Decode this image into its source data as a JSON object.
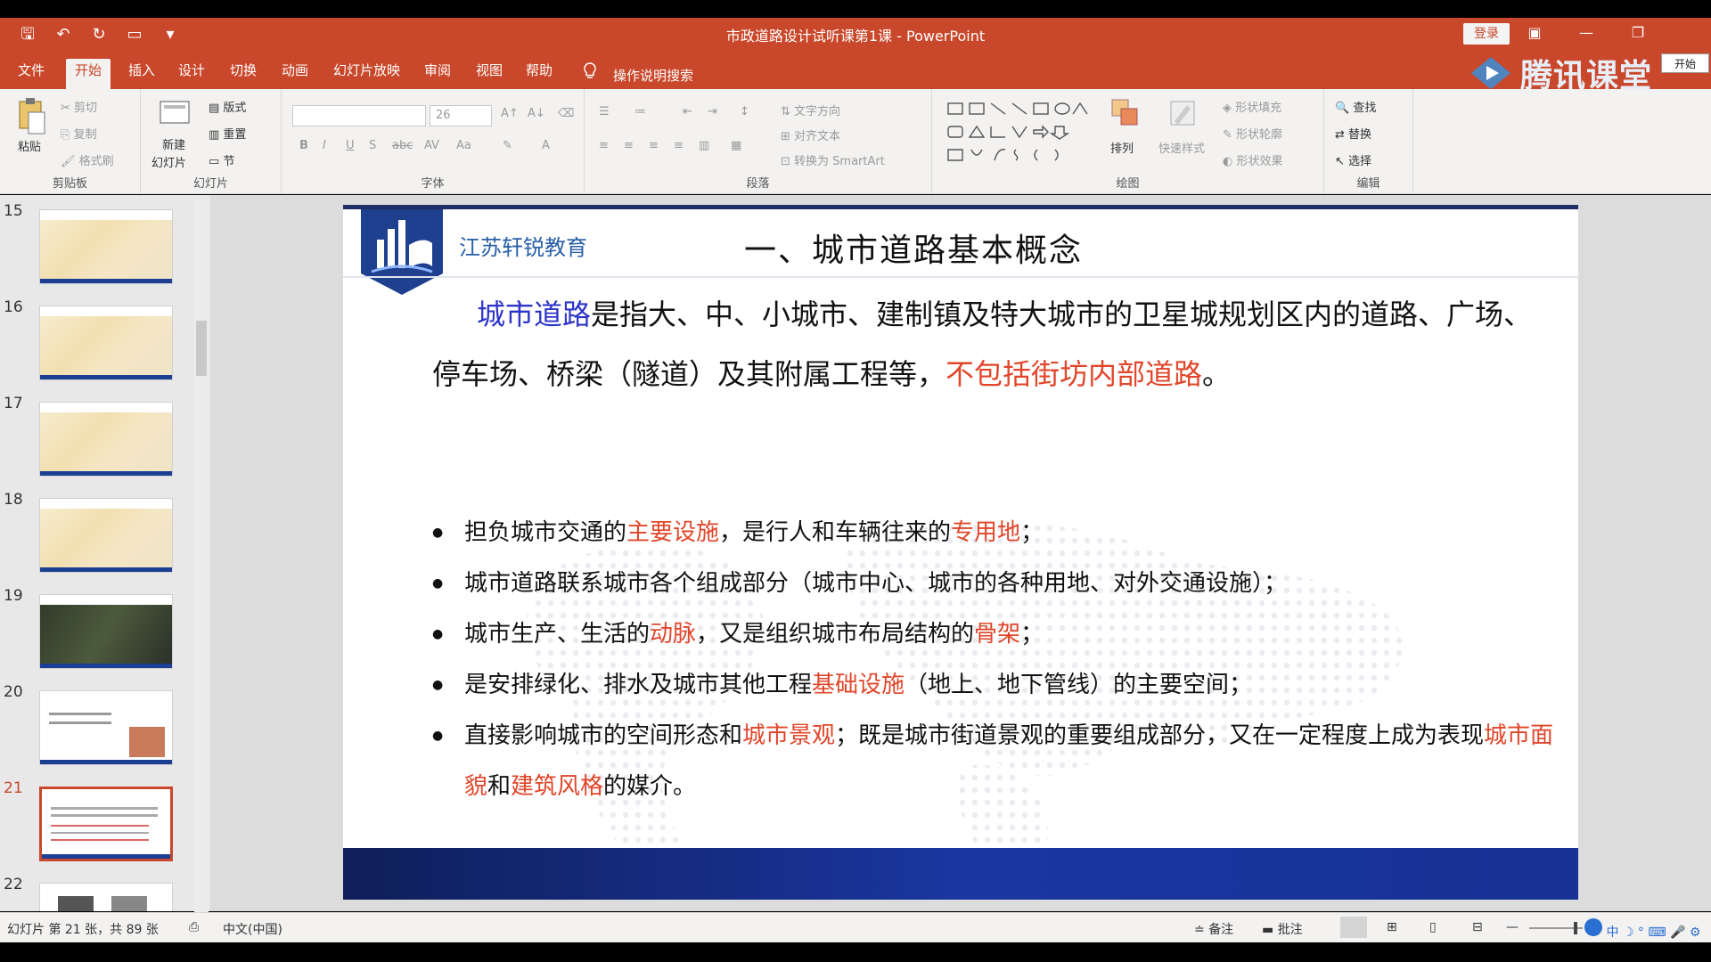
{
  "window": {
    "title": "市政道路设计试听课第1课 - PowerPoint",
    "login_label": "登录",
    "brand_name": "腾讯课堂",
    "brand_start": "开始"
  },
  "tabs": [
    {
      "label": "文件"
    },
    {
      "label": "开始",
      "active": true
    },
    {
      "label": "插入"
    },
    {
      "label": "设计"
    },
    {
      "label": "切换"
    },
    {
      "label": "动画"
    },
    {
      "label": "幻灯片放映"
    },
    {
      "label": "审阅"
    },
    {
      "label": "视图"
    },
    {
      "label": "帮助"
    }
  ],
  "tellme": "操作说明搜索",
  "ribbon": {
    "clipboard": {
      "label": "剪贴板",
      "paste": "粘贴",
      "cut": "剪切",
      "copy": "复制",
      "format_painter": "格式刷"
    },
    "slides": {
      "label": "幻灯片",
      "new_slide_1": "新建",
      "new_slide_2": "幻灯片",
      "layout": "版式",
      "reset": "重置",
      "section": "节"
    },
    "font": {
      "label": "字体",
      "size": "26"
    },
    "paragraph": {
      "label": "段落",
      "text_direction": "文字方向",
      "align_text": "对齐文本",
      "smartart": "转换为 SmartArt"
    },
    "drawing": {
      "label": "绘图",
      "arrange": "排列",
      "quick_styles": "快速样式",
      "shape_fill": "形状填充",
      "shape_outline": "形状轮廓",
      "shape_effects": "形状效果"
    },
    "editing": {
      "label": "编辑",
      "find": "查找",
      "replace": "替换",
      "select": "选择"
    }
  },
  "thumbnails": [
    {
      "number": "15",
      "kind": "map",
      "selected": false
    },
    {
      "number": "16",
      "kind": "map",
      "selected": false
    },
    {
      "number": "17",
      "kind": "map",
      "selected": false
    },
    {
      "number": "18",
      "kind": "map",
      "selected": false
    },
    {
      "number": "19",
      "kind": "dark",
      "selected": false
    },
    {
      "number": "20",
      "kind": "text",
      "selected": false
    },
    {
      "number": "21",
      "kind": "text",
      "selected": true
    },
    {
      "number": "22",
      "kind": "photo",
      "selected": false
    }
  ],
  "slide": {
    "company": "江苏轩锐教育",
    "title": "一、城市道路基本概念",
    "intro": {
      "p1": "城市道路",
      "p2": "是指大、中、小城市、建制镇及特大城市的卫星城规划区内的道路、广场、停车场、桥梁（隧道）及其附属工程等，",
      "p3": "不包括街坊内部道路",
      "p4": "。"
    },
    "bullets": [
      {
        "a": "担负城市交通的",
        "b": "主要设施",
        "c": "，是行人和车辆往来的",
        "d": "专用地",
        "e": "；"
      },
      {
        "a": "城市道路联系城市各个组成部分（城市中心、城市的各种用地、对外交通设施）；"
      },
      {
        "a": "城市生产、生活的",
        "b": "动脉",
        "c": "，又是组织城市布局结构的",
        "d": "骨架",
        "e": "；"
      },
      {
        "a": "是安排绿化、排水及城市其他工程",
        "b": "基础设施",
        "c": "（地上、地下管线）的主要空间；"
      },
      {
        "a": "直接影响城市的空间形态和",
        "b": "城市景观",
        "c": "；既是城市街道景观的重要组成部分，又在一定程度上成为表现",
        "d": "城市面貌",
        "e": "和",
        "f": "建筑风格",
        "g": "的媒介。"
      }
    ]
  },
  "status": {
    "slide_count": "幻灯片 第 21 张，共 89 张",
    "language": "中文(中国)",
    "notes": "备注",
    "comments": "批注"
  },
  "colors": {
    "accent": "#c9472a",
    "slide_band": "#1a36a0",
    "highlight_red": "#e1462a",
    "highlight_blue": "#2d34c9"
  }
}
